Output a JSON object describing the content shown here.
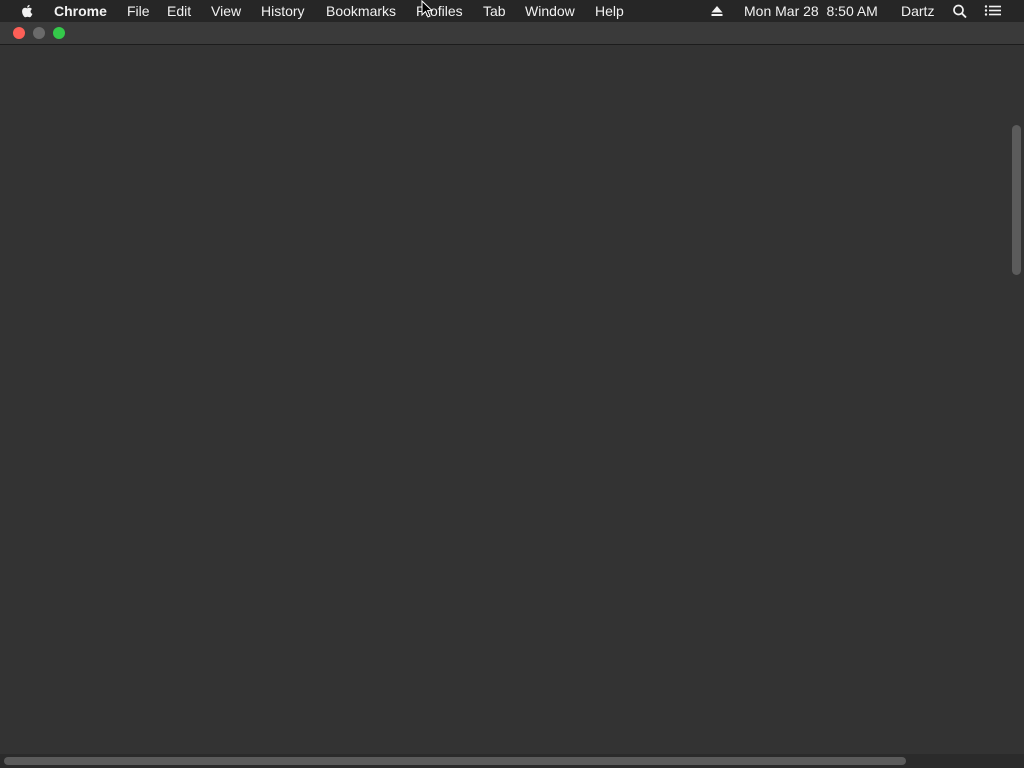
{
  "menubar": {
    "app_name": "Chrome",
    "menus": [
      "File",
      "Edit",
      "View",
      "History",
      "Bookmarks",
      "Profiles",
      "Tab",
      "Window",
      "Help"
    ],
    "datetime": "Mon Mar 28  8:50 AM",
    "user": "Dartz"
  },
  "icons": {
    "apple": "apple-icon",
    "eject": "eject-icon",
    "search": "search-icon",
    "notification_center": "list-icon"
  },
  "window": {
    "traffic_lights": {
      "close": "#fc5f57",
      "minimize": "#6a6a6a",
      "zoom": "#34c84a"
    }
  },
  "colors": {
    "page_background": "#333333",
    "menubar_background": "#262626"
  }
}
